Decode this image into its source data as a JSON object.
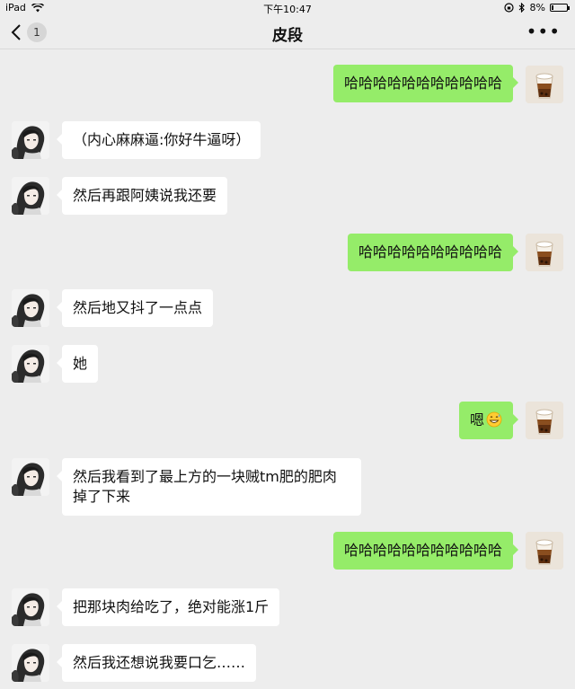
{
  "status_bar": {
    "device": "iPad",
    "time": "下午10:47",
    "battery": "8%"
  },
  "header": {
    "back_badge": "1",
    "title": "皮段"
  },
  "messages": [
    {
      "side": "right",
      "text": "哈哈哈哈哈哈哈哈哈哈哈"
    },
    {
      "side": "left",
      "text": "（内心麻麻逼:你好牛逼呀）"
    },
    {
      "side": "left",
      "text": "然后再跟阿姨说我还要"
    },
    {
      "side": "right",
      "text": "哈哈哈哈哈哈哈哈哈哈"
    },
    {
      "side": "left",
      "text": "然后地又抖了一点点"
    },
    {
      "side": "left",
      "text": "她"
    },
    {
      "side": "right",
      "text": "嗯",
      "emoji": "grinning-sweat-emoji"
    },
    {
      "side": "left",
      "line1": "然后我看到了最上方的一块贼tm肥的肥肉",
      "line2": "掉了下来"
    },
    {
      "side": "right",
      "text": "哈哈哈哈哈哈哈哈哈哈哈"
    },
    {
      "side": "left",
      "text": "把那块肉给吃了，绝对能涨1斤"
    },
    {
      "side": "left",
      "text": "然后我还想说我要口乞……"
    }
  ],
  "icons": {
    "left_avatar": "anime-girl-avatar",
    "right_avatar": "milk-tea-avatar"
  },
  "colors": {
    "background": "#ededed",
    "sent_bubble": "#95ec69",
    "received_bubble": "#ffffff"
  }
}
